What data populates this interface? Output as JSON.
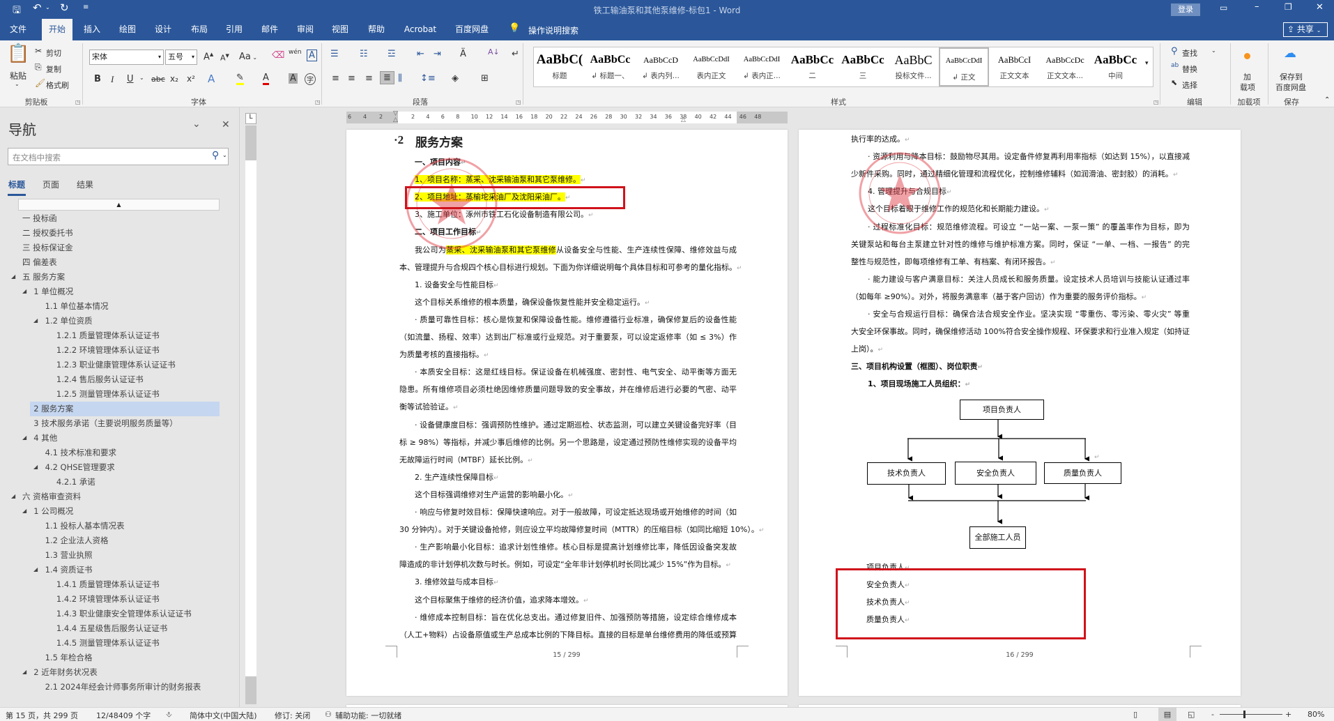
{
  "titlebar": {
    "doc_title": "铁工输油泵和其他泵维修-标包1  -  Word",
    "login_label": "登录",
    "share_label": "共享",
    "icons": [
      "save-icon",
      "undo-icon",
      "redo-icon",
      "customize-icon",
      "ribbon-display-icon",
      "minimize-icon",
      "restore-icon",
      "close-icon"
    ]
  },
  "tabs": [
    "文件",
    "开始",
    "插入",
    "绘图",
    "设计",
    "布局",
    "引用",
    "邮件",
    "审阅",
    "视图",
    "帮助",
    "Acrobat",
    "百度网盘"
  ],
  "active_tab": "开始",
  "tell_me": "操作说明搜索",
  "ribbon": {
    "clipboard": {
      "paste": "粘贴",
      "cut": "剪切",
      "copy": "复制",
      "format_painter": "格式刷",
      "label": "剪贴板"
    },
    "font": {
      "name": "宋体",
      "size": "五号",
      "label": "字体",
      "bold": "B",
      "italic": "I",
      "underline": "U",
      "strike": "abc",
      "sub": "x₂",
      "sup": "x²",
      "case": "Aa",
      "phonetic": "wén",
      "enclose": "字"
    },
    "paragraph": {
      "label": "段落"
    },
    "styles": {
      "label": "样式",
      "items": [
        {
          "preview": "AaBbC(",
          "name": "标题"
        },
        {
          "preview": "AaBbCc",
          "name": "↲ 标题一、"
        },
        {
          "preview": "AaBbCcD",
          "name": "↲ 表内列..."
        },
        {
          "preview": "AaBbCcDdI",
          "name": "表内正文"
        },
        {
          "preview": "AaBbCcDdI",
          "name": "↲ 表内正..."
        },
        {
          "preview": "AaBbCc",
          "name": "二"
        },
        {
          "preview": "AaBbCc",
          "name": "三"
        },
        {
          "preview": "AaBbC",
          "name": "投标文件..."
        },
        {
          "preview": "AaBbCcDdI",
          "name": "↲ 正文"
        },
        {
          "preview": "AaBbCcI",
          "name": "正文文本"
        },
        {
          "preview": "AaBbCcDc",
          "name": "正文文本..."
        },
        {
          "preview": "AaBbCc",
          "name": "中间"
        }
      ],
      "selected": "↲ 正文"
    },
    "editing": {
      "find": "查找",
      "replace": "替换",
      "select": "选择",
      "label": "编辑"
    },
    "addins": {
      "button": "加载项",
      "label": "加载项",
      "line1": "加",
      "line2": "载项"
    },
    "save": {
      "line1": "保存到",
      "line2": "百度网盘",
      "label": "保存"
    }
  },
  "nav": {
    "title": "导航",
    "search_placeholder": "在文档中搜索",
    "tabs": [
      "标题",
      "页面",
      "结果"
    ],
    "active_tab": "标题",
    "items": [
      {
        "text": "一 投标函",
        "level": 0
      },
      {
        "text": "二 授权委托书",
        "level": 0
      },
      {
        "text": "三 投标保证金",
        "level": 0
      },
      {
        "text": "四 偏差表",
        "level": 0
      },
      {
        "text": "五 服务方案",
        "level": 0,
        "expanded": true
      },
      {
        "text": "1 单位概况",
        "level": 1,
        "expanded": true
      },
      {
        "text": "1.1 单位基本情况",
        "level": 2
      },
      {
        "text": "1.2 单位资质",
        "level": 2,
        "expanded": true
      },
      {
        "text": "1.2.1 质量管理体系认证证书",
        "level": 3
      },
      {
        "text": "1.2.2 环境管理体系认证证书",
        "level": 3
      },
      {
        "text": "1.2.3 职业健康管理体系认证证书",
        "level": 3
      },
      {
        "text": "1.2.4 售后服务认证证书",
        "level": 3
      },
      {
        "text": "1.2.5 测量管理体系认证证书",
        "level": 3
      },
      {
        "text": "2 服务方案",
        "level": 1,
        "selected": true
      },
      {
        "text": "3 技术服务承诺（主要说明服务质量等）",
        "level": 1
      },
      {
        "text": "4 其他",
        "level": 1,
        "expanded": true
      },
      {
        "text": "4.1 技术标准和要求",
        "level": 2
      },
      {
        "text": "4.2 QHSE管理要求",
        "level": 2,
        "expanded": true
      },
      {
        "text": "4.2.1 承诺",
        "level": 3
      },
      {
        "text": "六 资格审查资料",
        "level": 0,
        "expanded": true
      },
      {
        "text": "1 公司概况",
        "level": 1,
        "expanded": true
      },
      {
        "text": "1.1 投标人基本情况表",
        "level": 2
      },
      {
        "text": "1.2 企业法人资格",
        "level": 2
      },
      {
        "text": "1.3 营业执照",
        "level": 2
      },
      {
        "text": "1.4 资质证书",
        "level": 2,
        "expanded": true
      },
      {
        "text": "1.4.1 质量管理体系认证证书",
        "level": 3
      },
      {
        "text": "1.4.2 环境管理体系认证证书",
        "level": 3
      },
      {
        "text": "1.4.3 职业健康安全管理体系认证证书",
        "level": 3
      },
      {
        "text": "1.4.4 五星级售后服务认证证书",
        "level": 3
      },
      {
        "text": "1.4.5 测量管理体系认证证书",
        "level": 3
      },
      {
        "text": "1.5 年检合格",
        "level": 2
      },
      {
        "text": "2 近年财务状况表",
        "level": 1,
        "expanded": true
      },
      {
        "text": "2.1 2024年经会计师事务所审计的财务报表",
        "level": 2
      }
    ]
  },
  "ruler": {
    "numbers": [
      "6",
      "4",
      "2",
      "2",
      "4",
      "6",
      "8",
      "10",
      "12",
      "14",
      "16",
      "18",
      "20",
      "22",
      "24",
      "26",
      "28",
      "30",
      "32",
      "34",
      "36",
      "38",
      "40",
      "42",
      "44",
      "46",
      "48"
    ]
  },
  "page1": {
    "heading_num": "·2",
    "heading": "服务方案",
    "lines": [
      {
        "text": "一、项目内容",
        "style": "bold-indent"
      },
      {
        "text": "1、项目名称：蒸采、沈采输油泵和其它泵维修。",
        "style": "indent",
        "highlight": "1、项目名称：蒸采、沈采输油泵和其它泵维修。"
      },
      {
        "text": "2、项目地址：蒸榆坨采油厂及沈阳采油厂。",
        "style": "indent",
        "highlight": "2、项目地址：蒸榆坨采油厂及沈阳采油厂。"
      },
      {
        "text": "3、施工单位：涿州市铁工石化设备制造有限公司。",
        "style": "indent"
      },
      {
        "text": "二、项目工作目标",
        "style": "bold-indent"
      },
      {
        "text": "我公司为蒸采、沈采输油泵和其它泵维修从设备安全与性能、生产连续性保障、维修效益与成",
        "style": "indent-justify",
        "highlight": "蒸采、沈采输油泵和其它泵维修"
      },
      {
        "text": "本、管理提升与合规四个核心目标进行规划。下面为你详细说明每个具体目标和可参考的量化指标。",
        "style": "plain"
      },
      {
        "text": "1. 设备安全与性能目标",
        "style": "indent"
      },
      {
        "text": "这个目标关系维修的根本质量，确保设备恢复性能并安全稳定运行。",
        "style": "indent"
      },
      {
        "text": "· 质量可靠性目标：核心是恢复和保障设备性能。维修遵循行业标准，确保修复后的设备性能",
        "style": "indent-justify"
      },
      {
        "text": "（如流量、扬程、效率）达到出厂标准或行业规范。对于重要泵，可以设定返修率（如 ≤ 3%）作",
        "style": "justify"
      },
      {
        "text": "为质量考核的直接指标。",
        "style": "plain"
      },
      {
        "text": "· 本质安全目标：这是红线目标。保证设备在机械强度、密封性、电气安全、动平衡等方面无",
        "style": "indent-justify"
      },
      {
        "text": "隐患。所有维修项目必须杜绝因维修质量问题导致的安全事故，并在维修后进行必要的气密、动平",
        "style": "justify"
      },
      {
        "text": "衡等试验验证。",
        "style": "plain"
      },
      {
        "text": "· 设备健康度目标：强调预防性维护。通过定期巡检、状态监测，可以建立关键设备完好率（目",
        "style": "indent-justify"
      },
      {
        "text": "标 ≥ 98%）等指标，并减少事后维修的比例。另一个思路是，设定通过预防性维修实现的设备平均",
        "style": "justify"
      },
      {
        "text": "无故障运行时间（MTBF）延长比例。",
        "style": "plain"
      },
      {
        "text": "2. 生产连续性保障目标",
        "style": "indent"
      },
      {
        "text": "这个目标强调维修对生产运营的影响最小化。",
        "style": "indent"
      },
      {
        "text": "· 响应与修复时效目标：保障快速响应。对于一般故障，可设定抵达现场或开始维修的时间（如",
        "style": "indent-justify"
      },
      {
        "text": "30 分钟内）。对于关键设备抢修，则应设立平均故障修复时间（MTTR）的压缩目标（如同比缩短 10%）。",
        "style": "plain"
      },
      {
        "text": "· 生产影响最小化目标：追求计划性维修。核心目标是提高计划维修比率，降低因设备突发故",
        "style": "indent-justify"
      },
      {
        "text": "障造成的非计划停机次数与时长。例如，可设定“全年非计划停机时长同比减少 15%”作为目标。",
        "style": "plain"
      },
      {
        "text": "3. 维修效益与成本目标",
        "style": "indent"
      },
      {
        "text": "这个目标聚焦于维修的经济价值，追求降本增效。",
        "style": "indent"
      },
      {
        "text": "· 维修成本控制目标：旨在优化总支出。通过修复旧件、加强预防等措施，设定综合维修成本",
        "style": "indent-justify"
      },
      {
        "text": "（人工+物料）占设备原值或生产总成本比例的下降目标。直接的目标是单台维修费用的降低或预算",
        "style": "justify"
      }
    ],
    "page_number": "15 / 299"
  },
  "page2": {
    "lines": [
      {
        "text": "执行率的达成。",
        "style": "plain"
      },
      {
        "text": "· 资源利用与降本目标：鼓励物尽其用。设定备件修复再利用率指标（如达到 15%），以直接减",
        "style": "indent-justify"
      },
      {
        "text": "少新件采购。同时，通过精细化管理和流程优化，控制维修辅料（如润滑油、密封胶）的消耗。",
        "style": "plain"
      },
      {
        "text": "4. 管理提升与合规目标",
        "style": "indent"
      },
      {
        "text": "这个目标着眼于维修工作的规范化和长期能力建设。",
        "style": "indent"
      },
      {
        "text": "· 过程标准化目标：规范维修流程。可设立 “一站一案、一泵一策” 的覆盖率作为目标，即为",
        "style": "indent-justify"
      },
      {
        "text": "关键泵站和每台主泵建立针对性的维修与维护标准方案。同时，保证 “一单、一档、一报告” 的完",
        "style": "justify"
      },
      {
        "text": "整性与规范性，即每项维修有工单、有档案、有闭环报告。",
        "style": "plain"
      },
      {
        "text": "· 能力建设与客户满意目标：关注人员成长和服务质量。设定技术人员培训与技能认证通过率",
        "style": "indent-justify"
      },
      {
        "text": "（如每年 ≥90%）。对外，将服务满意率（基于客户回访）作为重要的服务评价指标。",
        "style": "plain"
      },
      {
        "text": "· 安全与合规运行目标：确保合法合规安全作业。坚决实现 “零重伤、零污染、零火灾” 等重",
        "style": "indent-justify"
      },
      {
        "text": "大安全环保事故。同时，确保维修活动 100%符合安全操作规程、环保要求和行业准入规定（如持证",
        "style": "justify"
      },
      {
        "text": "上岗）。",
        "style": "plain"
      },
      {
        "text": "三、项目机构设置（框图）、岗位职责",
        "style": "bold"
      },
      {
        "text": "1、项目现场施工人员组织：",
        "style": "bold-indent"
      }
    ],
    "org_chart": {
      "top": "项目负责人",
      "middle": [
        "技术负责人",
        "安全负责人",
        "质量负责人"
      ],
      "bottom": "全部施工人员"
    },
    "roles": [
      "项目负责人",
      "安全负责人",
      "技术负责人",
      "质量负责人"
    ],
    "page_number": "16 / 299"
  },
  "annotation_color": "#d0121b",
  "status": {
    "page": "第 15 页，共 299 页",
    "words": "12/48409 个字",
    "language": "简体中文(中国大陆)",
    "track_changes": "修订: 关闭",
    "accessibility": "辅助功能: 一切就绪",
    "zoom": "80%",
    "zoom_level_percent": 80
  }
}
